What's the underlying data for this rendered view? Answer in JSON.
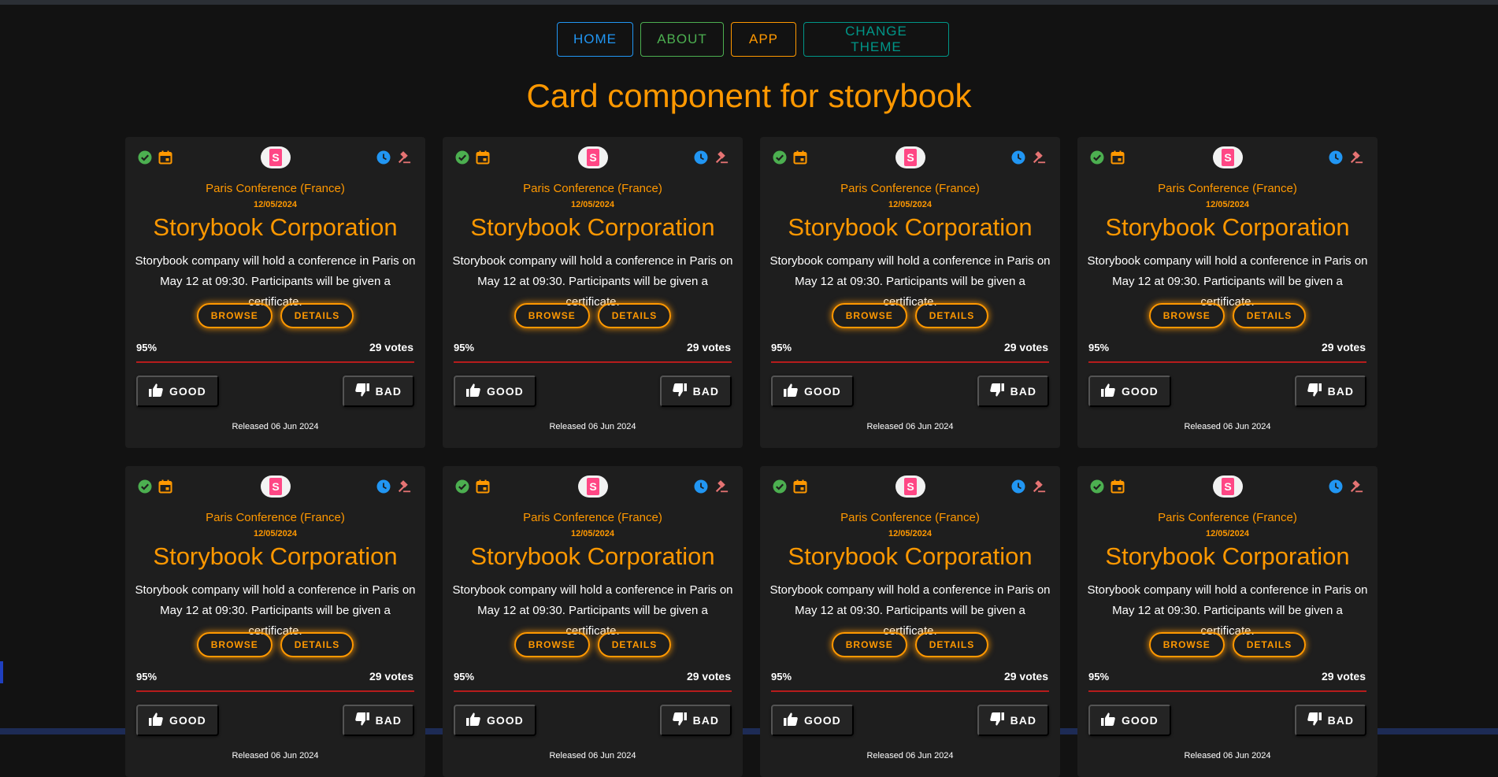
{
  "nav": {
    "home": "HOME",
    "about": "ABOUT",
    "app": "APP",
    "theme": "CHANGE THEME"
  },
  "page_title": "Card component for storybook",
  "card": {
    "logo_letter": "S",
    "subtitle": "Paris Conference (France)",
    "date": "12/05/2024",
    "company": "Storybook Corporation",
    "description": "Storybook company will hold a conference in Paris on May 12 at 09:30. Participants will be given a certificate.",
    "browse_label": "BROWSE",
    "details_label": "DETAILS",
    "rating": "95%",
    "votes": "29 votes",
    "good_label": "GOOD",
    "bad_label": "BAD",
    "released": "Released 06 Jun 2024"
  },
  "icons": [
    "check-circle-icon",
    "calendar-icon",
    "storybook-logo-icon",
    "clock-icon",
    "gavel-icon",
    "thumb-up-icon",
    "thumb-down-icon"
  ],
  "colors": {
    "background": "#121212",
    "card": "#1e1e1e",
    "accent": "#ff9800",
    "blue": "#2196f3",
    "green": "#4caf50",
    "teal": "#009688",
    "divider": "#b71c1c",
    "storybook_pink": "#ff4785"
  }
}
